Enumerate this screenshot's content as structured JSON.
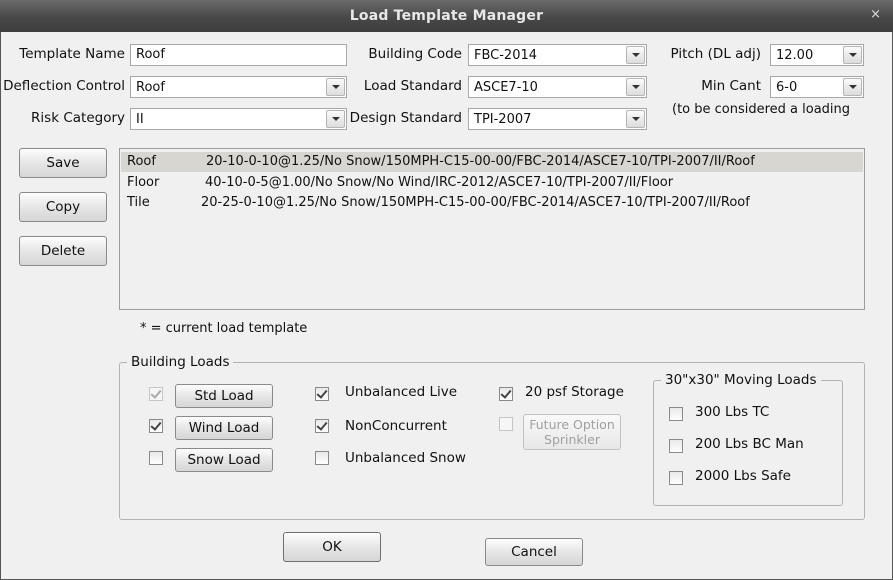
{
  "window": {
    "title": "Load Template Manager",
    "close_glyph": "×"
  },
  "fields": {
    "template_name": {
      "label": "Template Name",
      "value": "Roof"
    },
    "deflection_control": {
      "label": "Deflection Control",
      "value": "Roof"
    },
    "risk_category": {
      "label": "Risk Category",
      "value": "II"
    },
    "building_code": {
      "label": "Building Code",
      "value": "FBC-2014"
    },
    "load_standard": {
      "label": "Load Standard",
      "value": "ASCE7-10"
    },
    "design_standard": {
      "label": "Design Standard",
      "value": "TPI-2007"
    },
    "pitch": {
      "label": "Pitch (DL adj)",
      "value": "12.00"
    },
    "min_cant": {
      "label": "Min Cant",
      "value": "6-0"
    },
    "min_cant_note": "(to be considered a loading"
  },
  "actions": {
    "save": "Save",
    "copy": "Copy",
    "delete": "Delete",
    "ok": "OK",
    "cancel": "Cancel"
  },
  "templates": [
    {
      "name": "Roof",
      "desc": "20-10-0-10@1.25/No Snow/150MPH-C15-00-00/FBC-2014/ASCE7-10/TPI-2007/II/Roof",
      "selected": true
    },
    {
      "name": "Floor",
      "desc": "40-10-0-5@1.00/No Snow/No Wind/IRC-2012/ASCE7-10/TPI-2007/II/Floor",
      "selected": false
    },
    {
      "name": "Tile",
      "desc": "20-25-0-10@1.25/No Snow/150MPH-C15-00-00/FBC-2014/ASCE7-10/TPI-2007/II/Roof",
      "selected": false
    }
  ],
  "current_note": "* = current load template",
  "building_loads": {
    "title": "Building Loads",
    "std_load": {
      "label": "Std Load",
      "checked": true,
      "enabled": false
    },
    "wind_load": {
      "label": "Wind Load",
      "checked": true,
      "enabled": true
    },
    "snow_load": {
      "label": "Snow Load",
      "checked": false,
      "enabled": true
    },
    "unbalanced_live": {
      "label": "Unbalanced Live",
      "checked": true
    },
    "nonconcurrent": {
      "label": "NonConcurrent",
      "checked": true
    },
    "unbalanced_snow": {
      "label": "Unbalanced Snow",
      "checked": false
    },
    "storage": {
      "label": "20 psf Storage",
      "checked": true
    },
    "future_option": {
      "line1": "Future Option",
      "line2": "Sprinkler",
      "checked": false,
      "enabled": false
    }
  },
  "moving_loads": {
    "title": "30\"x30\" Moving Loads",
    "items": [
      {
        "label": "300 Lbs TC",
        "checked": false
      },
      {
        "label": "200 Lbs BC Man",
        "checked": false
      },
      {
        "label": "2000 Lbs Safe",
        "checked": false
      }
    ]
  }
}
